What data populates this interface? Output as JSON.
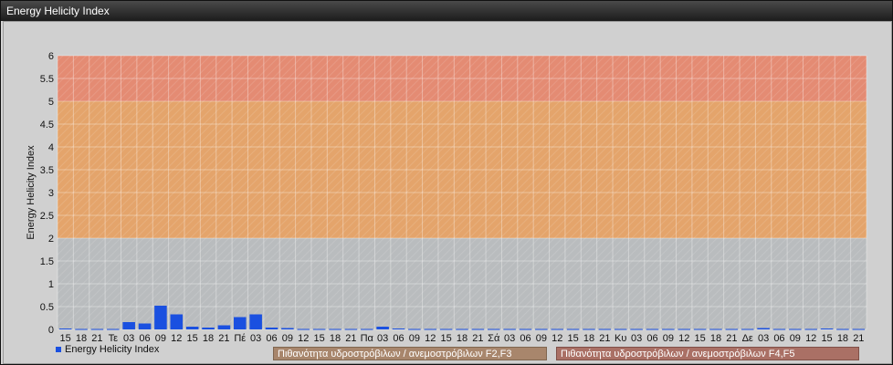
{
  "window": {
    "title": "Energy Helicity Index"
  },
  "legend": {
    "series_label": "Energy Helicity Index",
    "band1_label": "Πιθανότητα υδροστρόβιλων / ανεμοστρόβιλων F2,F3",
    "band2_label": "Πιθανότητα υδροστρόβιλων / ανεμοστρόβιλων F4,F5"
  },
  "chart_data": {
    "type": "bar",
    "ylabel": "Energy Helicity Index",
    "xlabel": "",
    "ylim": [
      0,
      6
    ],
    "yticks": [
      "0",
      "0.5",
      "1",
      "1.5",
      "2",
      "2.5",
      "3",
      "3.5",
      "4",
      "4.5",
      "5",
      "5.5",
      "6"
    ],
    "bands": [
      {
        "from": 2,
        "to": 5,
        "color": "#e4a46b",
        "label": "Πιθανότητα υδροστρόβιλων / ανεμοστρόβιλων F2,F3"
      },
      {
        "from": 5,
        "to": 6,
        "color": "#e48b73",
        "label": "Πιθανότητα υδροστρόβιλων / ανεμοστρόβιλων F4,F5"
      }
    ],
    "bar_color": "#1a50e0",
    "categories": [
      "15",
      "18",
      "21",
      "Τε",
      "03",
      "06",
      "09",
      "12",
      "15",
      "18",
      "21",
      "Πέ",
      "03",
      "06",
      "09",
      "12",
      "15",
      "18",
      "21",
      "Πα",
      "03",
      "06",
      "09",
      "12",
      "15",
      "18",
      "21",
      "Σά",
      "03",
      "06",
      "09",
      "12",
      "15",
      "18",
      "21",
      "Κυ",
      "03",
      "06",
      "09",
      "12",
      "15",
      "18",
      "21",
      "Δε",
      "03",
      "06",
      "09",
      "12",
      "15",
      "18",
      "21"
    ],
    "series": [
      {
        "name": "Energy Helicity Index",
        "values": [
          0.02,
          0.01,
          0.01,
          0.01,
          0.16,
          0.13,
          0.52,
          0.33,
          0.06,
          0.04,
          0.09,
          0.27,
          0.33,
          0.04,
          0.03,
          0.01,
          0.01,
          0.01,
          0.01,
          0.01,
          0.06,
          0.02,
          0.01,
          0.01,
          0.01,
          0.01,
          0.01,
          0.01,
          0.01,
          0.01,
          0.01,
          0.01,
          0.01,
          0.01,
          0.01,
          0.01,
          0.01,
          0.01,
          0.01,
          0.01,
          0.01,
          0.01,
          0.01,
          0.01,
          0.03,
          0.01,
          0.01,
          0.01,
          0.02,
          0.01,
          0.01
        ]
      }
    ],
    "grid": true,
    "legend_position": "bottom"
  }
}
